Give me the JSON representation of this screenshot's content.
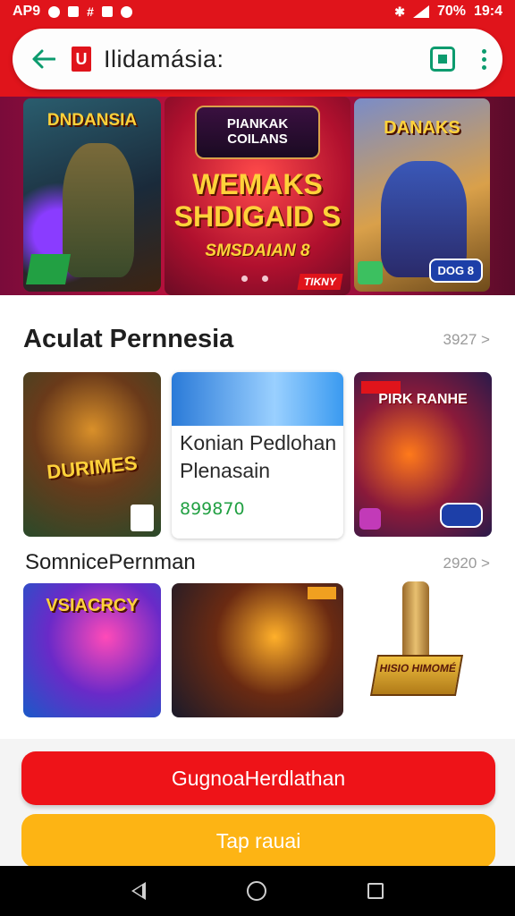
{
  "status_bar": {
    "left_label": "AP9",
    "battery": "70%",
    "time": "19:4"
  },
  "header": {
    "logo_letter": "U",
    "title": "Ilidamásia:"
  },
  "banner": {
    "left_title": "DNDANSIA",
    "center_emblem": "PIANKAK COILANS",
    "center_headline": "WEMAKS SHDIGAID S",
    "center_subline": "SMSDAIAN 8",
    "center_tag": "TIKNY",
    "right_title": "DANAKS",
    "right_badge": "DOG 8"
  },
  "section1": {
    "title": "Aculat Pernnesia",
    "more": "3927 >",
    "cards": [
      {
        "title": "DURIMES"
      },
      {
        "name": "Konian Pedlohan Plenasain",
        "price": "899870"
      },
      {
        "title": "PIRK RANHE"
      }
    ]
  },
  "section2": {
    "title": "SomnicePernman",
    "more": "2920 >",
    "cards": [
      {
        "title": "VSIACRCY"
      },
      {},
      {
        "plaque": "HISIO HIMOMÉ"
      }
    ]
  },
  "buttons": {
    "primary": "GugnoaHerdlathan",
    "secondary": "Tap rauai"
  },
  "colors": {
    "brand_red": "#e0141b",
    "accent_green": "#0c9b6e",
    "button_yellow": "#fdb414"
  }
}
